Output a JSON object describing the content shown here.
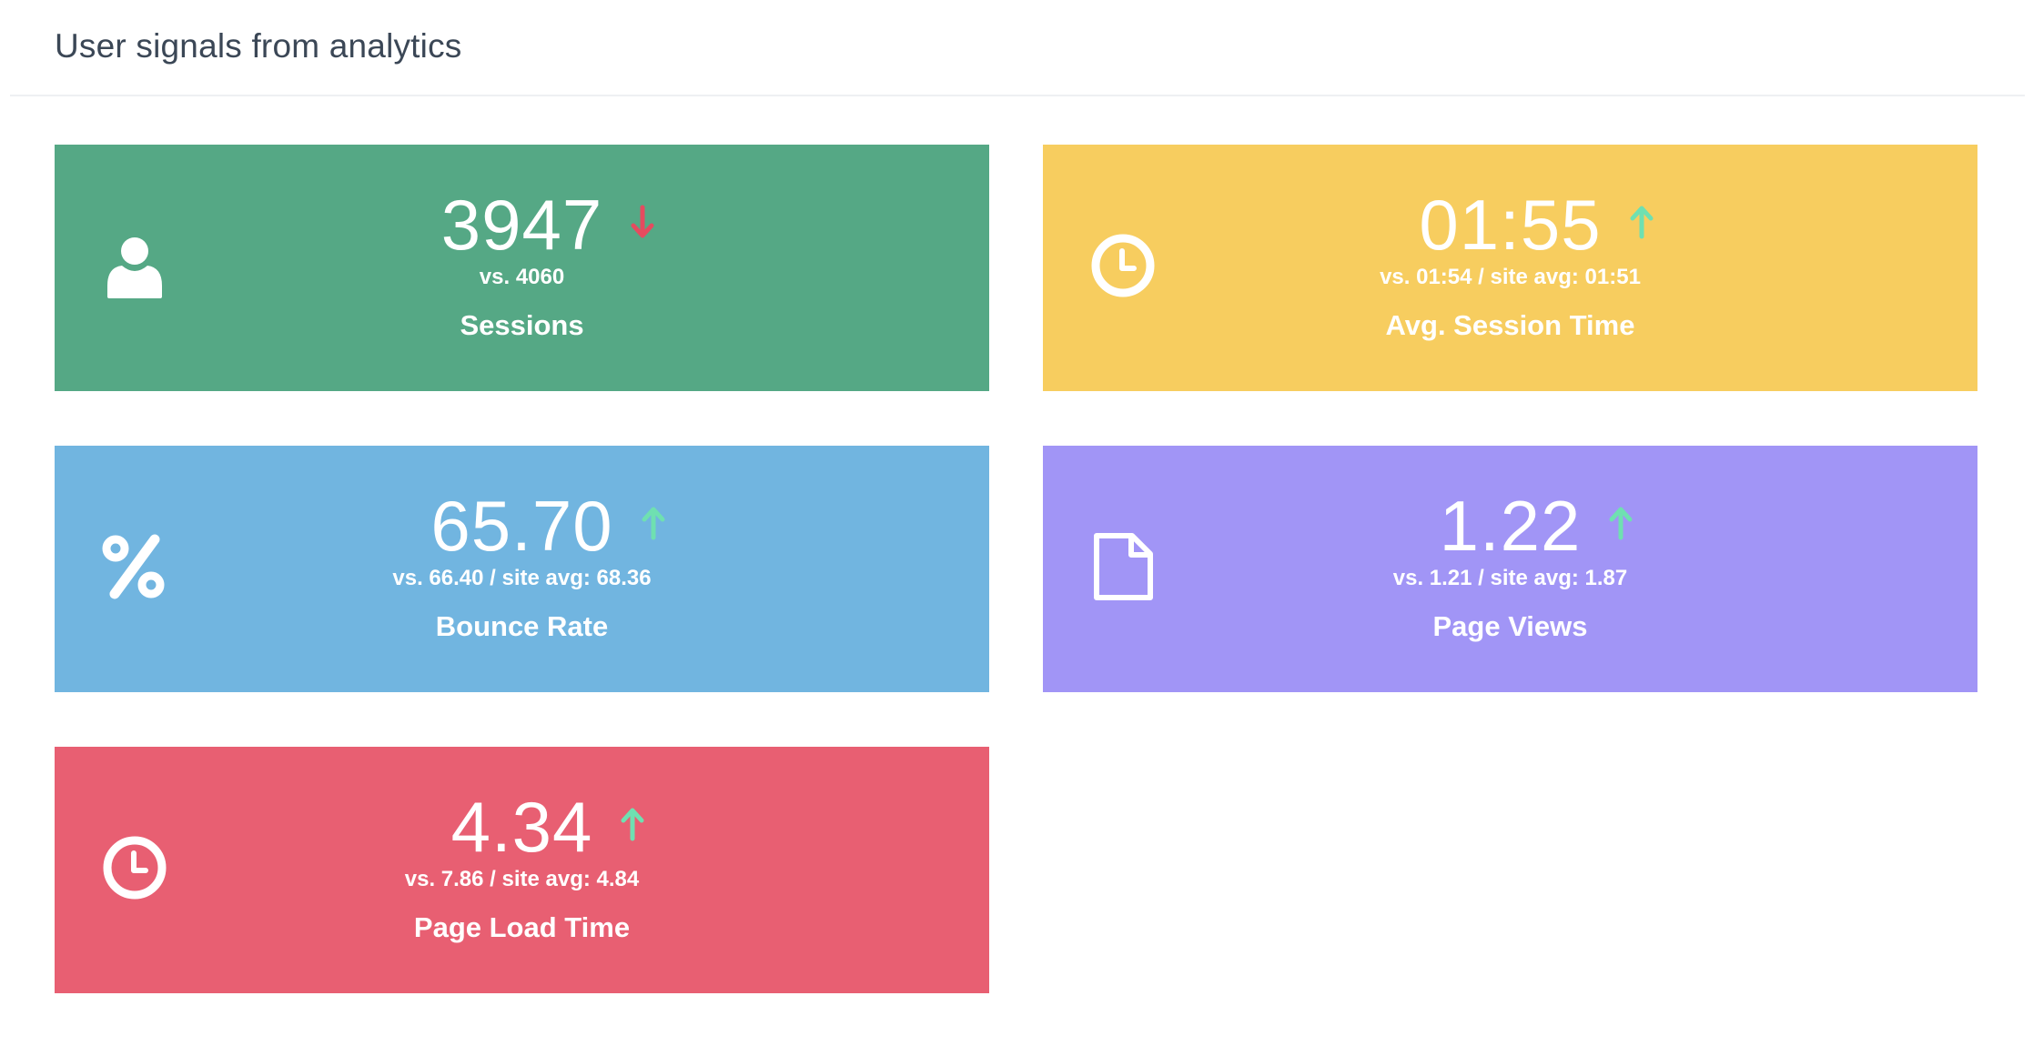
{
  "page": {
    "title": "User signals from analytics"
  },
  "colors": {
    "sessions": "#55a885",
    "session_time": "#f7cd5f",
    "bounce_rate": "#71b5e0",
    "page_views": "#a195f6",
    "page_load": "#e85f72",
    "trend_up": "#6fe0b1",
    "trend_down": "#e54b5f"
  },
  "cards": [
    {
      "id": "sessions",
      "icon": "user-icon",
      "value": "3947",
      "trend": "down",
      "compare": "vs. 4060",
      "label": "Sessions"
    },
    {
      "id": "session_time",
      "icon": "clock-icon",
      "value": "01:55",
      "trend": "up",
      "compare": "vs. 01:54 / site avg: 01:51",
      "label": "Avg. Session Time"
    },
    {
      "id": "bounce_rate",
      "icon": "percent-icon",
      "value": "65.70",
      "trend": "up",
      "compare": "vs. 66.40 / site avg: 68.36",
      "label": "Bounce Rate"
    },
    {
      "id": "page_views",
      "icon": "document-icon",
      "value": "1.22",
      "trend": "up",
      "compare": "vs. 1.21 / site avg: 1.87",
      "label": "Page Views"
    },
    {
      "id": "page_load",
      "icon": "clock-icon",
      "value": "4.34",
      "trend": "up",
      "compare": "vs. 7.86 / site avg: 4.84",
      "label": "Page Load Time"
    }
  ]
}
